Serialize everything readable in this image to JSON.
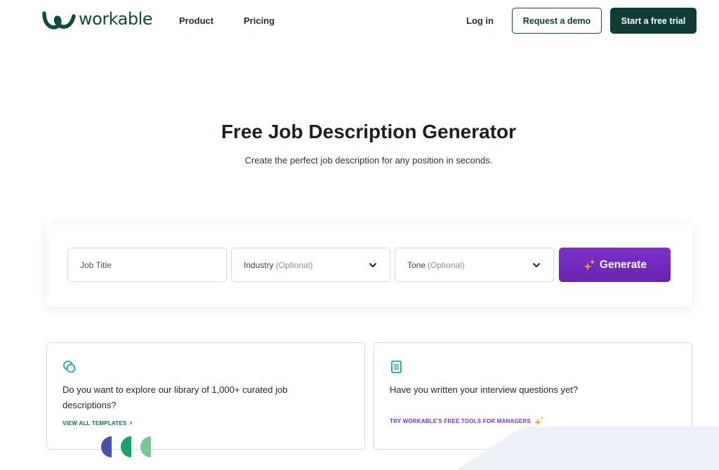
{
  "header": {
    "logo_text": "workable",
    "nav": [
      "Product",
      "Pricing"
    ],
    "login": "Log in",
    "demo_button": "Request a demo",
    "trial_button": "Start a free trial"
  },
  "hero": {
    "title": "Free Job Description Generator",
    "subtitle": "Create the perfect job description for any position in seconds."
  },
  "generator": {
    "job_title_placeholder": "Job Title",
    "industry_label": "Industry",
    "industry_optional": "(Optional)",
    "tone_label": "Tone",
    "tone_optional": "(Optional)",
    "generate_button": "Generate"
  },
  "cards": [
    {
      "text": "Do you want to explore our library of 1,000+ curated job descriptions?",
      "link": "VIEW ALL TEMPLATES",
      "link_arrow": "›"
    },
    {
      "text": "Have you written your interview questions yet?",
      "link": "TRY WORKABLE'S FREE TOOLS FOR MANAGERS"
    }
  ],
  "colors": {
    "brand_green": "#0f3d35",
    "accent_purple": "#7d2fc9",
    "link_teal": "#0e6b5a",
    "link_purple": "#7a2fc2",
    "icon_teal": "#1aa99a"
  }
}
